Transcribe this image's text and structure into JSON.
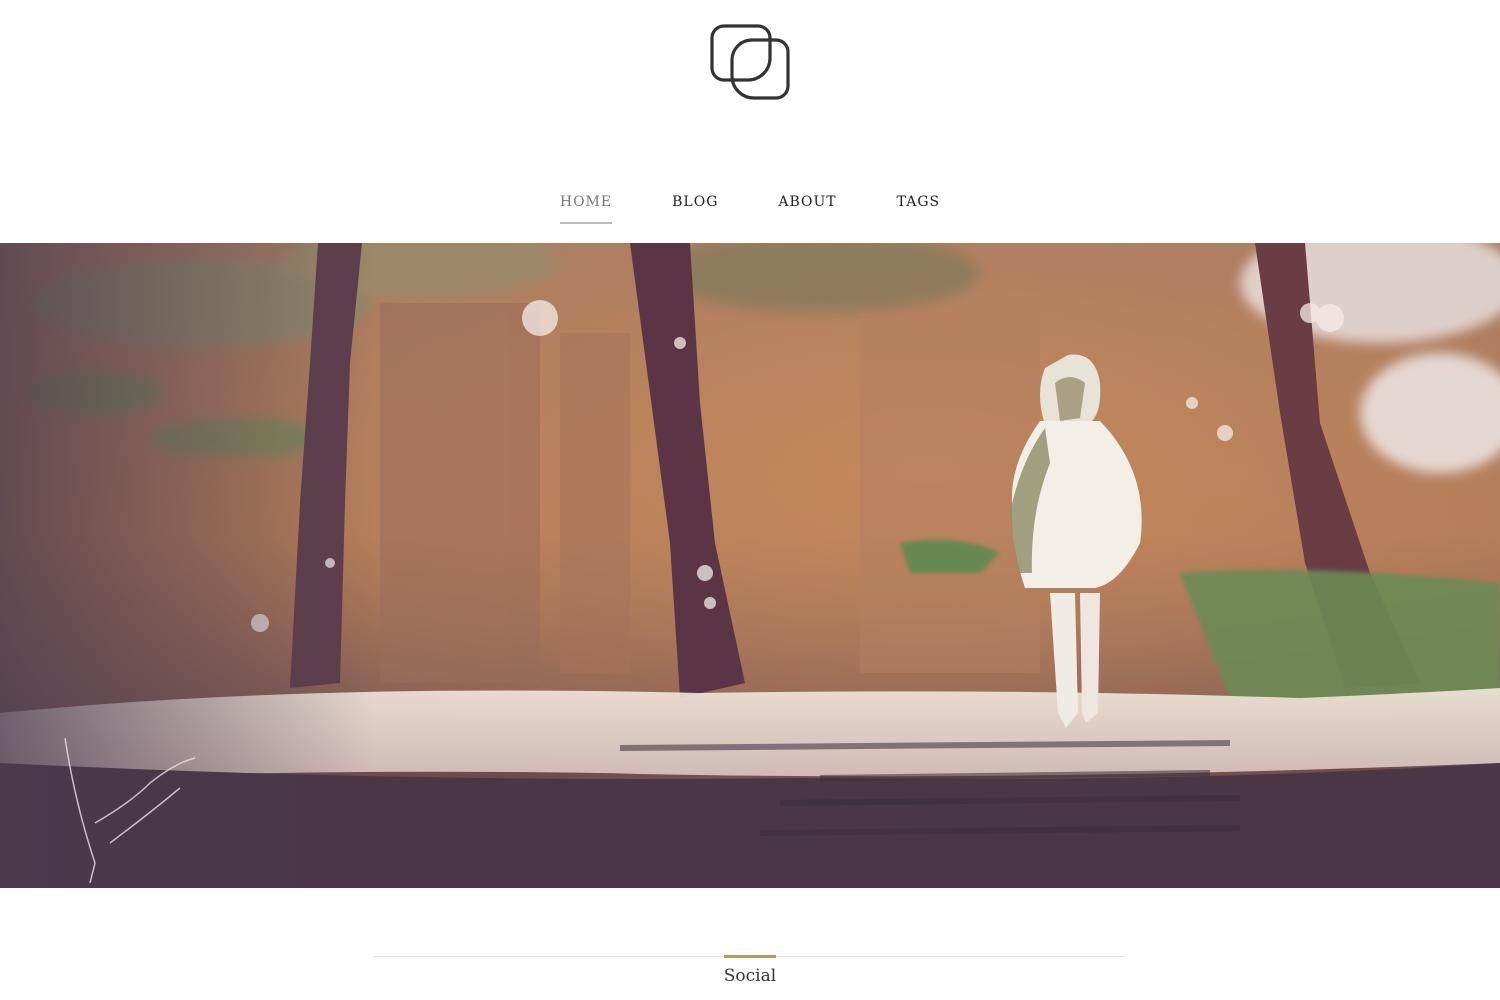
{
  "header": {
    "logo_icon": "overlapping-squares-logo-icon"
  },
  "nav": {
    "items": [
      {
        "label": "HOME",
        "active": true
      },
      {
        "label": "BLOG",
        "active": false
      },
      {
        "label": "ABOUT",
        "active": false
      },
      {
        "label": "TAGS",
        "active": false
      }
    ]
  },
  "hero": {
    "image": "painted-forest-girl-walking-illustration"
  },
  "section": {
    "title": "Social"
  },
  "colors": {
    "accent": "#b89a5c",
    "nav_text": "#222222",
    "nav_active": "#777777"
  }
}
